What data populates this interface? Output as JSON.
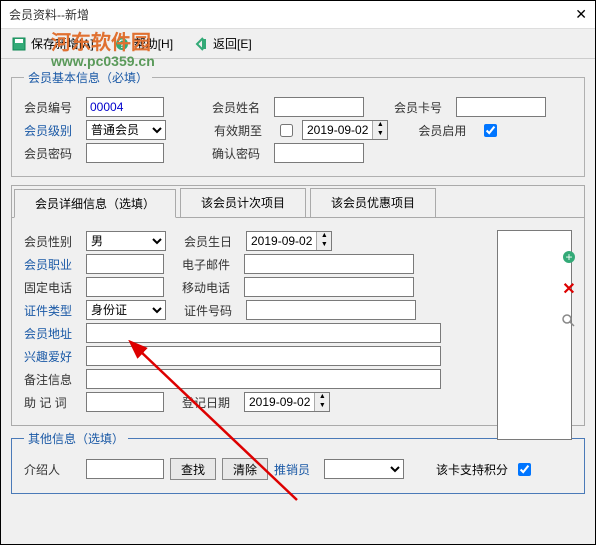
{
  "window": {
    "title": "会员资料--新增"
  },
  "toolbar": {
    "save_new": "保存新增[A]",
    "help": "帮助[H]",
    "back": "返回[E]"
  },
  "watermark": {
    "line1": "河东软件园",
    "line2": "www.pc0359.cn"
  },
  "basic": {
    "legend": "会员基本信息（必填）",
    "member_no_lbl": "会员编号",
    "member_no": "00004",
    "member_name_lbl": "会员姓名",
    "member_name": "",
    "card_no_lbl": "会员卡号",
    "card_no": "",
    "level_lbl": "会员级别",
    "level": "普通会员",
    "expire_lbl": "有效期至",
    "expire_date": "2019-09-02",
    "enable_lbl": "会员启用",
    "password_lbl": "会员密码",
    "password": "",
    "confirm_lbl": "确认密码",
    "confirm": ""
  },
  "tabs": {
    "detail": "会员详细信息（选填）",
    "count_items": "该会员计次项目",
    "pref_items": "该会员优惠项目"
  },
  "detail": {
    "gender_lbl": "会员性别",
    "gender": "男",
    "birthday_lbl": "会员生日",
    "birthday": "2019-09-02",
    "job_lbl": "会员职业",
    "job": "",
    "email_lbl": "电子邮件",
    "email": "",
    "tel_lbl": "固定电话",
    "tel": "",
    "mobile_lbl": "移动电话",
    "mobile": "",
    "idtype_lbl": "证件类型",
    "idtype": "身份证",
    "idno_lbl": "证件号码",
    "idno": "",
    "address_lbl": "会员地址",
    "address": "",
    "hobby_lbl": "兴趣爱好",
    "hobby": "",
    "remark_lbl": "备注信息",
    "remark": "",
    "mnemonic_lbl": "助 记 词",
    "mnemonic": "",
    "regdate_lbl": "登记日期",
    "regdate": "2019-09-02"
  },
  "other": {
    "legend": "其他信息（选填）",
    "referrer_lbl": "介绍人",
    "referrer": "",
    "find_btn": "查找",
    "clear_btn": "清除",
    "promoter_lbl": "推销员",
    "promoter": "",
    "points_lbl": "该卡支持积分"
  }
}
